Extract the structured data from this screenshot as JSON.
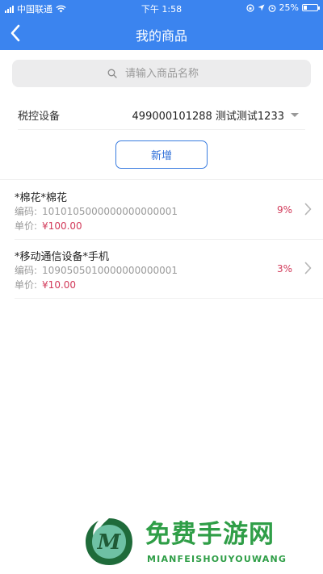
{
  "status_bar": {
    "carrier": "中国联通",
    "time": "下午 1:58",
    "battery_text": "25%",
    "battery_level": 0.25
  },
  "header": {
    "title": "我的商品"
  },
  "search": {
    "placeholder": "请输入商品名称",
    "value": ""
  },
  "device": {
    "label": "税控设备",
    "selected": "499000101288 测试测试1233"
  },
  "actions": {
    "add_label": "新增"
  },
  "products": [
    {
      "name": "*棉花*棉花",
      "code_label": "编码:",
      "code": "1010105000000000000001",
      "price_label": "单价:",
      "price": "¥100.00",
      "tax_rate": "9%"
    },
    {
      "name": "*移动通信设备*手机",
      "code_label": "编码:",
      "code": "1090505010000000000001",
      "price_label": "单价:",
      "price": "¥10.00",
      "tax_rate": "3%"
    }
  ],
  "watermark": {
    "title": "免费手游网",
    "subtitle": "MIANFEISHOUYOUWANG",
    "logo_letter": "M"
  },
  "colors": {
    "primary": "#3b84ef",
    "price": "#d23a5a",
    "watermark": "#2f9e47"
  }
}
